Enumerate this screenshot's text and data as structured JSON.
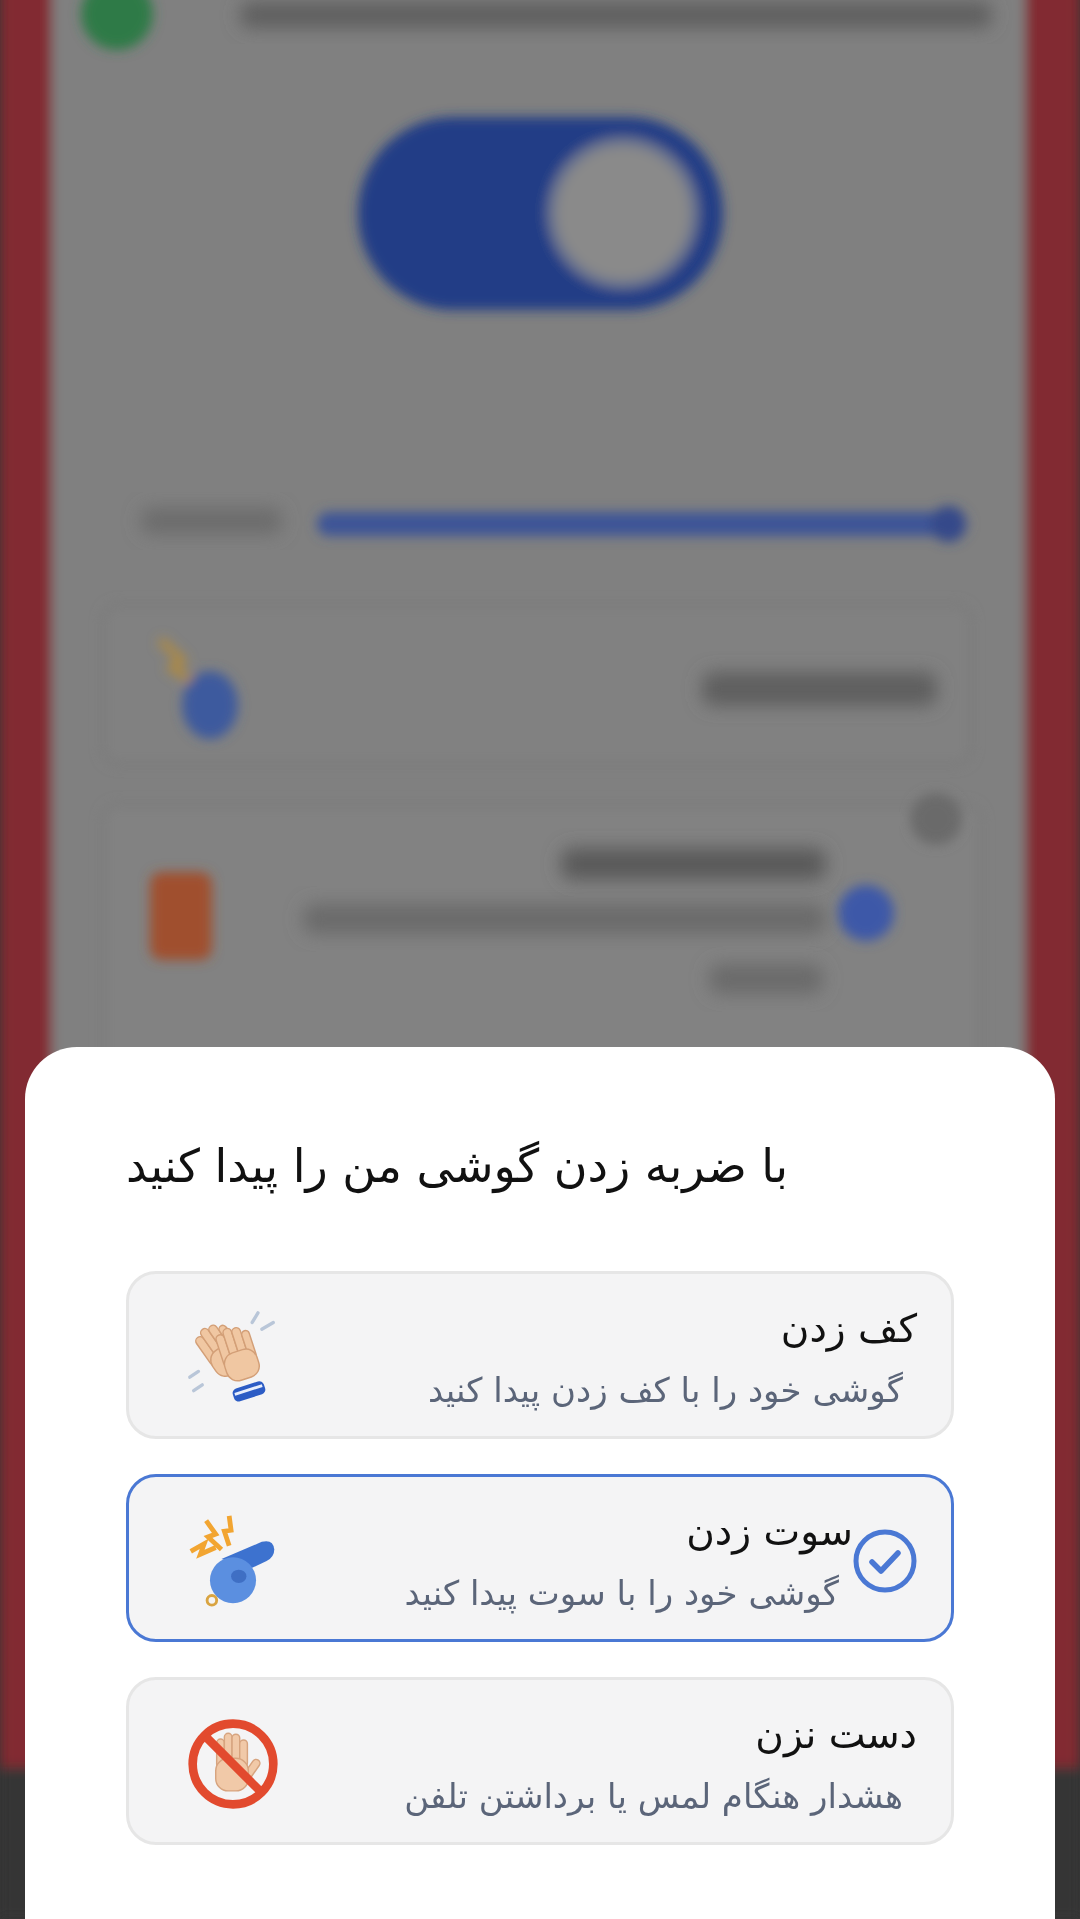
{
  "backdrop": {
    "toggle": {
      "on": true
    },
    "slider": {
      "level": 0.97
    }
  },
  "sheet": {
    "title": "با ضربه زدن گوشی من را پیدا کنید",
    "options": [
      {
        "kind": "clap",
        "title": "کف زدن",
        "subtitle": "گوشی خود را با کف زدن پیدا کنید",
        "selected": false
      },
      {
        "kind": "whistle",
        "title": "سوت زدن",
        "subtitle": "گوشی خود را با سوت پیدا کنید",
        "selected": true
      },
      {
        "kind": "no_touch",
        "title": "دست نزن",
        "subtitle": "هشدار هنگام لمس یا برداشتن تلفن",
        "selected": false
      }
    ]
  }
}
